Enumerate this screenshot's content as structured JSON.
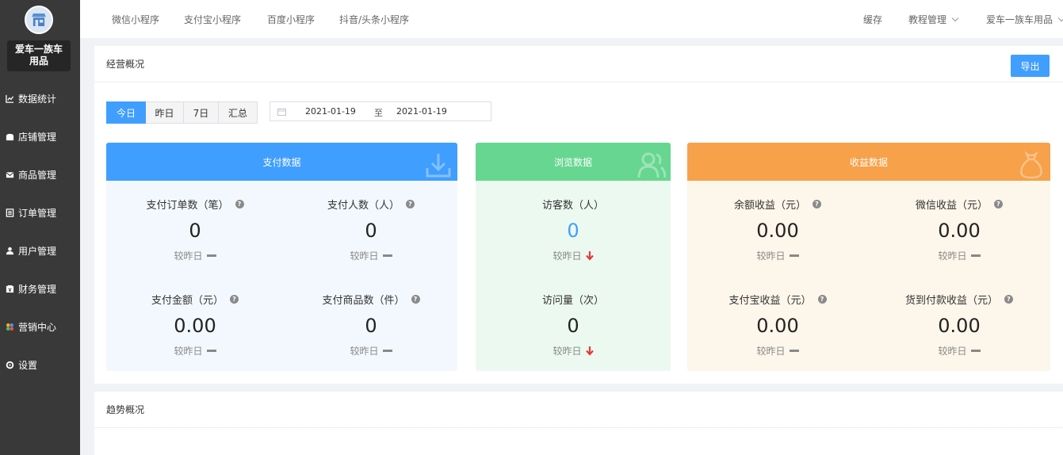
{
  "sidebar": {
    "shop_name_line1": "爱车一族车",
    "shop_name_line2": "用品",
    "items": [
      {
        "label": "数据统计",
        "icon": "chart-line-icon"
      },
      {
        "label": "店铺管理",
        "icon": "store-icon"
      },
      {
        "label": "商品管理",
        "icon": "envelope-icon"
      },
      {
        "label": "订单管理",
        "icon": "list-alt-icon"
      },
      {
        "label": "用户管理",
        "icon": "user-icon"
      },
      {
        "label": "财务管理",
        "icon": "wallet-icon"
      },
      {
        "label": "营销中心",
        "icon": "puzzle-icon"
      },
      {
        "label": "设置",
        "icon": "gear-icon"
      }
    ]
  },
  "topbar": {
    "tabs": [
      "微信小程序",
      "支付宝小程序",
      "百度小程序",
      "抖音/头条小程序"
    ],
    "cache": "缓存",
    "tutorial": "教程管理",
    "shop": "爱车一族车用品"
  },
  "overview": {
    "title": "经营概况",
    "export": "导出",
    "ranges": [
      "今日",
      "昨日",
      "7日",
      "汇总"
    ],
    "active_range": "今日",
    "date_start": "2021-01-19",
    "date_sep": "至",
    "date_end": "2021-01-19"
  },
  "cards": {
    "payment": {
      "title": "支付数据",
      "metrics": [
        {
          "label": "支付订单数（笔）",
          "value": "0",
          "compare": "较昨日",
          "trend": "flat"
        },
        {
          "label": "支付人数（人）",
          "value": "0",
          "compare": "较昨日",
          "trend": "flat"
        },
        {
          "label": "支付金额（元）",
          "value": "0.00",
          "compare": "较昨日",
          "trend": "flat"
        },
        {
          "label": "支付商品数（件）",
          "value": "0",
          "compare": "较昨日",
          "trend": "flat"
        }
      ]
    },
    "browse": {
      "title": "浏览数据",
      "metrics": [
        {
          "label": "访客数（人）",
          "value": "0",
          "compare": "较昨日",
          "trend": "down"
        },
        {
          "label": "访问量（次）",
          "value": "0",
          "compare": "较昨日",
          "trend": "down"
        }
      ]
    },
    "earnings": {
      "title": "收益数据",
      "metrics": [
        {
          "label": "余额收益（元）",
          "value": "0.00",
          "compare": "较昨日",
          "trend": "flat"
        },
        {
          "label": "微信收益（元）",
          "value": "0.00",
          "compare": "较昨日",
          "trend": "flat"
        },
        {
          "label": "支付宝收益（元）",
          "value": "0.00",
          "compare": "较昨日",
          "trend": "flat"
        },
        {
          "label": "货到付款收益（元）",
          "value": "0.00",
          "compare": "较昨日",
          "trend": "flat"
        }
      ]
    }
  },
  "trend": {
    "title": "趋势概况"
  },
  "colors": {
    "primary": "#409eff",
    "payment_header": "#409eff",
    "browse_header": "#67d690",
    "earnings_header": "#f7a14a",
    "down_arrow": "#e33b3b",
    "sidebar_bg": "#393939"
  }
}
